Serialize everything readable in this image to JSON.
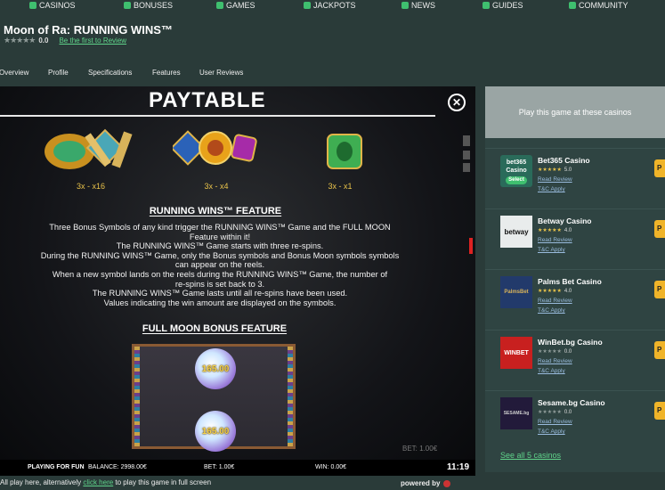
{
  "nav": {
    "items": [
      {
        "label": "CASINOS",
        "icon": "casino-chip-icon"
      },
      {
        "label": "BONUSES",
        "icon": "gift-icon"
      },
      {
        "label": "GAMES",
        "icon": "dice-icon"
      },
      {
        "label": "JACKPOTS",
        "icon": "trophy-icon"
      },
      {
        "label": "NEWS",
        "icon": "newspaper-icon"
      },
      {
        "label": "GUIDES",
        "icon": "book-icon"
      },
      {
        "label": "COMMUNITY",
        "icon": "people-icon"
      }
    ]
  },
  "game": {
    "title": "Moon of Ra: RUNNING WINS™",
    "stars": "★★★★★",
    "rating": "0.0",
    "review_link": "Be the first to Review"
  },
  "tabs": [
    "Overview",
    "Profile",
    "Specifications",
    "Features",
    "User Reviews"
  ],
  "paytable": {
    "title": "PAYTABLE",
    "payouts": [
      "3x - x16",
      "3x - x4",
      "3x - x1"
    ],
    "running_wins_title": "RUNNING WINS™ FEATURE",
    "running_wins_lines": [
      "Three Bonus Symbols of any kind trigger the RUNNING WINS™ Game and the FULL MOON",
      "Feature within it!",
      "The RUNNING WINS™ Game starts with three re-spins.",
      "During the RUNNING WINS™ Game, only the Bonus symbols and Bonus Moon symbols symbols",
      "can appear on the reels.",
      "When a new symbol lands on the reels during the RUNNING WINS™ Game, the number of",
      "re-spins is set back to 3.",
      "The RUNNING WINS™ Game lasts until all re-spins have been used.",
      "Values indicating the win amount are displayed on the symbols."
    ],
    "full_moon_title": "FULL MOON BONUS FEATURE",
    "moon_values": [
      "165.00",
      "165.00"
    ]
  },
  "status_bar": {
    "mode": "PLAYING FOR FUN",
    "balance": "BALANCE: 2998.00€",
    "bet": "BET: 1.00€",
    "win": "WIN: 0.00€",
    "time": "11:19",
    "bet_bg": "BET: 1.00€"
  },
  "sidebar": {
    "heading": "Play this game at these casinos",
    "casinos": [
      {
        "name": "Bet365 Casino",
        "rating": "5.0",
        "logo": "bet365 Casino",
        "badge": "Select",
        "logo_bg": "#2a6b5a"
      },
      {
        "name": "Betway Casino",
        "rating": "4.0",
        "logo": "betway",
        "badge": "",
        "logo_bg": "#e9ecec"
      },
      {
        "name": "Palms Bet Casino",
        "rating": "4.0",
        "logo": "PalmsBet",
        "badge": "",
        "logo_bg": "#223a6b"
      },
      {
        "name": "WinBet.bg Casino",
        "rating": "0.0",
        "logo": "WINBET",
        "badge": "",
        "logo_bg": "#c8201f"
      },
      {
        "name": "Sesame.bg Casino",
        "rating": "0.0",
        "logo": "SESAME.bg",
        "badge": "",
        "logo_bg": "#221a3a"
      }
    ],
    "read_review": "Read Review",
    "tc_apply": "T&C Apply",
    "play_label": "P",
    "see_all": "See all 5 casinos"
  },
  "footer": {
    "prefix": "All play here, alternatively ",
    "link": "click here",
    "suffix": " to play this game in full screen",
    "powered_by": "powered by"
  },
  "colors": {
    "accent": "#5fd38a",
    "gold": "#e8c24a",
    "page_bg": "#2a3b39"
  }
}
